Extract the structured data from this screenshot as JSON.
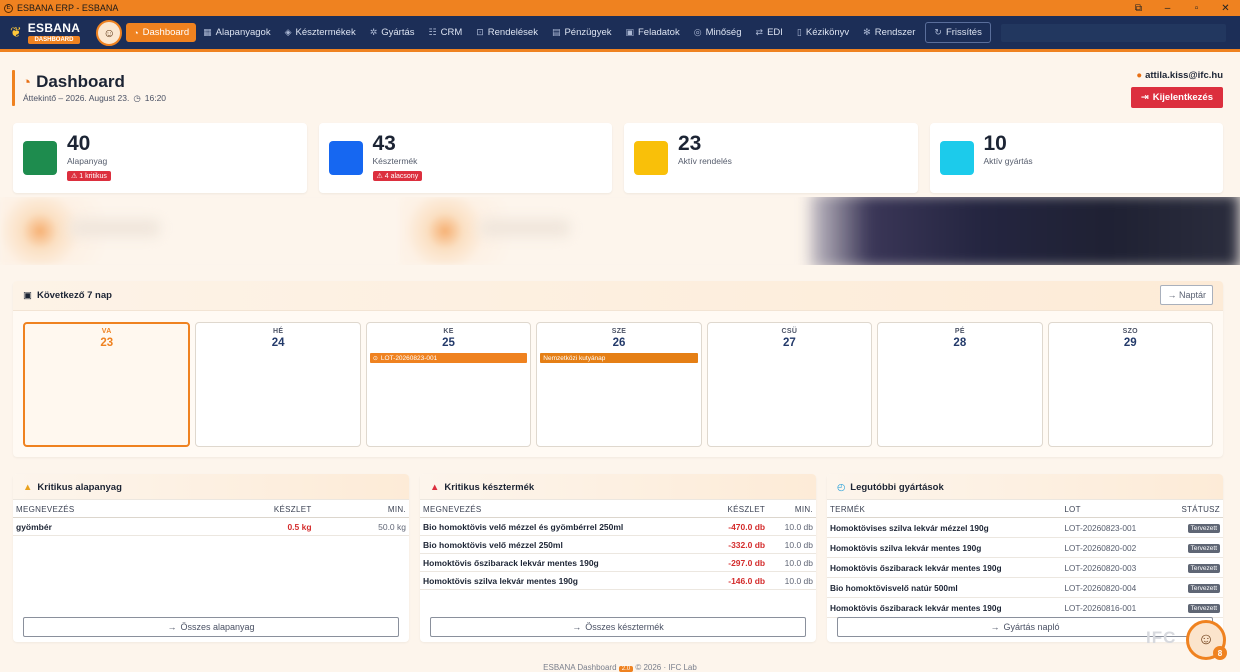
{
  "window": {
    "title": "ESBANA ERP - ESBANA"
  },
  "nav": {
    "brand": "ESBANA",
    "brand_sub": "DASHBOARD",
    "items": [
      {
        "label": "Dashboard",
        "icon": "gauge-icon"
      },
      {
        "label": "Alapanyagok",
        "icon": "boxes-icon"
      },
      {
        "label": "Késztermékek",
        "icon": "tag-icon"
      },
      {
        "label": "Gyártás",
        "icon": "gear-icon"
      },
      {
        "label": "CRM",
        "icon": "users-icon"
      },
      {
        "label": "Rendelések",
        "icon": "bag-icon"
      },
      {
        "label": "Pénzügyek",
        "icon": "money-icon"
      },
      {
        "label": "Feladatok",
        "icon": "calendar-icon"
      },
      {
        "label": "Minőség",
        "icon": "shield-check-icon"
      },
      {
        "label": "EDI",
        "icon": "arrows-icon"
      },
      {
        "label": "Kézikönyv",
        "icon": "book-icon"
      },
      {
        "label": "Rendszer",
        "icon": "cog-icon"
      }
    ],
    "refresh": "Frissítés"
  },
  "header": {
    "title": "Dashboard",
    "subtitle": "Áttekintő – 2026. August 23.",
    "time": "16:20",
    "user": "attila.kiss@ifc.hu",
    "logout": "Kijelentkezés"
  },
  "stats": [
    {
      "value": "40",
      "label": "Alapanyag",
      "badge": "1 kritikus",
      "color": "#1e8c4e"
    },
    {
      "value": "43",
      "label": "Késztermék",
      "badge": "4 alacsony",
      "color": "#1667f1"
    },
    {
      "value": "23",
      "label": "Aktív rendelés",
      "badge": "",
      "color": "#f9c009"
    },
    {
      "value": "10",
      "label": "Aktív gyártás",
      "badge": "",
      "color": "#1ccbeb"
    }
  ],
  "week": {
    "title": "Következő 7 nap",
    "button": "Naptár",
    "days": [
      {
        "name": "VA",
        "date": "23",
        "event": ""
      },
      {
        "name": "HÉ",
        "date": "24",
        "event": ""
      },
      {
        "name": "KE",
        "date": "25",
        "event": "LOT-20260823-001"
      },
      {
        "name": "SZE",
        "date": "26",
        "event": "Nemzetközi kutyánap"
      },
      {
        "name": "CSÜ",
        "date": "27",
        "event": ""
      },
      {
        "name": "PÉ",
        "date": "28",
        "event": ""
      },
      {
        "name": "SZO",
        "date": "29",
        "event": ""
      }
    ]
  },
  "critical_raw": {
    "title": "Kritikus alapanyag",
    "headers": [
      "MEGNEVEZÉS",
      "KÉSZLET",
      "MIN."
    ],
    "rows": [
      {
        "name": "gyömbér",
        "stock": "0.5 kg",
        "min": "50.0 kg"
      }
    ],
    "button": "Összes alapanyag"
  },
  "critical_finished": {
    "title": "Kritikus késztermék",
    "headers": [
      "MEGNEVEZÉS",
      "KÉSZLET",
      "MIN."
    ],
    "rows": [
      {
        "name": "Bio homoktövis velő mézzel és gyömbérrel 250ml",
        "stock": "-470.0 db",
        "min": "10.0 db"
      },
      {
        "name": "Bio homoktövis velő mézzel 250ml",
        "stock": "-332.0 db",
        "min": "10.0 db"
      },
      {
        "name": "Homoktövis őszibarack lekvár mentes 190g",
        "stock": "-297.0 db",
        "min": "10.0 db"
      },
      {
        "name": "Homoktövis szilva lekvár mentes 190g",
        "stock": "-146.0 db",
        "min": "10.0 db"
      }
    ],
    "button": "Összes késztermék"
  },
  "recent_production": {
    "title": "Legutóbbi gyártások",
    "headers": [
      "TERMÉK",
      "LOT",
      "STÁTUSZ"
    ],
    "rows": [
      {
        "name": "Homoktövises szilva lekvár mézzel 190g",
        "lot": "LOT-20260823-001",
        "status": "Tervezett"
      },
      {
        "name": "Homoktövis szilva lekvár mentes 190g",
        "lot": "LOT-20260820-002",
        "status": "Tervezett"
      },
      {
        "name": "Homoktövis őszibarack lekvár mentes 190g",
        "lot": "LOT-20260820-003",
        "status": "Tervezett"
      },
      {
        "name": "Bio homoktövisvelő natúr 500ml",
        "lot": "LOT-20260820-004",
        "status": "Tervezett"
      },
      {
        "name": "Homoktövis őszibarack lekvár mentes 190g",
        "lot": "LOT-20260816-001",
        "status": "Tervezett"
      }
    ],
    "button": "Gyártás napló"
  },
  "footer": {
    "left": "ESBANA Dashboard",
    "version": "2.0",
    "right": "© 2026 · IFC Lab"
  },
  "widget": {
    "logo": "IFC",
    "badge": "8"
  }
}
